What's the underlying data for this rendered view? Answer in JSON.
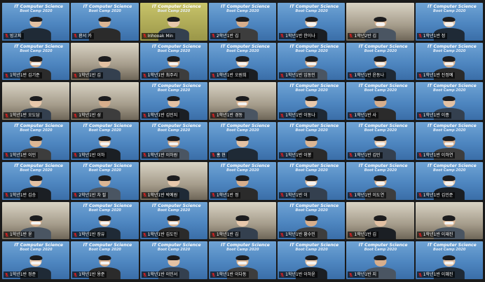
{
  "app": {
    "name": "Video Meeting Gallery View"
  },
  "banner": {
    "line1": "IT Computer Science",
    "line2": "Boot Camp 2020"
  },
  "colors": {
    "banner_blue": "#4e86c0",
    "active_speaker_border": "#c7e04a",
    "muted_icon": "#e02020"
  },
  "participants": [
    {
      "name": "빙고피",
      "bg": "banner",
      "mask": false,
      "active": true
    },
    {
      "name": "환서 카",
      "bg": "banner",
      "mask": false
    },
    {
      "name": "Inhooak Min",
      "bg": "yellow",
      "mask": false
    },
    {
      "name": "2학년1반 김",
      "bg": "banner",
      "mask": false
    },
    {
      "name": "1학년1반 한이나",
      "bg": "banner",
      "mask": true
    },
    {
      "name": "1학년2반 김",
      "bg": "room",
      "mask": true
    },
    {
      "name": "1학년1반 정",
      "bg": "banner",
      "mask": true
    },
    {
      "name": "1학년1반 김기준",
      "bg": "banner",
      "mask": true
    },
    {
      "name": "1학년1반 김",
      "bg": "room",
      "mask": false
    },
    {
      "name": "1학년1반 최주리",
      "bg": "banner",
      "mask": true
    },
    {
      "name": "1학년1반 오원희",
      "bg": "banner",
      "mask": true
    },
    {
      "name": "1학년1반 임동인",
      "bg": "banner",
      "mask": true
    },
    {
      "name": "1학년1반 윤동나",
      "bg": "banner",
      "mask": true
    },
    {
      "name": "1학년1반 진정예",
      "bg": "banner",
      "mask": true
    },
    {
      "name": "1학년1반 오도담",
      "bg": "room",
      "mask": false
    },
    {
      "name": "1학년1반 성",
      "bg": "room",
      "mask": false
    },
    {
      "name": "1학년1반 김민지",
      "bg": "banner",
      "mask": false
    },
    {
      "name": "1학년1반 경동",
      "bg": "room",
      "mask": true
    },
    {
      "name": "1학년1반 이동나",
      "bg": "banner",
      "mask": false
    },
    {
      "name": "1학년1반 사",
      "bg": "banner",
      "mask": false
    },
    {
      "name": "1학년1반 이종",
      "bg": "banner",
      "mask": false
    },
    {
      "name": "1학년1반 이민",
      "bg": "banner",
      "mask": false
    },
    {
      "name": "1학년1반 이하",
      "bg": "banner",
      "mask": true
    },
    {
      "name": "1학년1반 이하원",
      "bg": "banner",
      "mask": true
    },
    {
      "name": "홍 현",
      "bg": "banner",
      "mask": false
    },
    {
      "name": "1학년1반 이봉",
      "bg": "banner",
      "mask": false
    },
    {
      "name": "1학년1반 김민",
      "bg": "banner",
      "mask": true
    },
    {
      "name": "1학년1반 이하연",
      "bg": "banner",
      "mask": true
    },
    {
      "name": "1학년1반 김승",
      "bg": "banner",
      "mask": false
    },
    {
      "name": "2학년1반 차 필",
      "bg": "banner",
      "mask": false
    },
    {
      "name": "1학년1반 박예원",
      "bg": "room",
      "mask": false
    },
    {
      "name": "1학년1반 정",
      "bg": "banner",
      "mask": false
    },
    {
      "name": "1학년1반 이",
      "bg": "banner",
      "mask": true
    },
    {
      "name": "1학년1반 이도연",
      "bg": "banner",
      "mask": true
    },
    {
      "name": "1학년1반 김민준",
      "bg": "banner",
      "mask": true
    },
    {
      "name": "1학년1반 윤",
      "bg": "room",
      "mask": true
    },
    {
      "name": "1학년1반 장유",
      "bg": "banner",
      "mask": true
    },
    {
      "name": "1학년1반 김도민",
      "bg": "banner",
      "mask": true
    },
    {
      "name": "1학년1반 김",
      "bg": "room",
      "mask": false
    },
    {
      "name": "1학년1반 황수민",
      "bg": "banner",
      "mask": false
    },
    {
      "name": "1학년1반 김",
      "bg": "room",
      "mask": false
    },
    {
      "name": "1학년1반 이재진",
      "bg": "room",
      "mask": true
    },
    {
      "name": "1학년1반 정준",
      "bg": "banner",
      "mask": true
    },
    {
      "name": "1학년1반 용준",
      "bg": "banner",
      "mask": true
    },
    {
      "name": "1학년1반 이민서",
      "bg": "banner",
      "mask": false
    },
    {
      "name": "1학년1반 이다동",
      "bg": "banner",
      "mask": true
    },
    {
      "name": "1학년1반 이하윤",
      "bg": "banner",
      "mask": true
    },
    {
      "name": "1학년1반 지",
      "bg": "banner",
      "mask": false
    },
    {
      "name": "1학년1반 이혜진",
      "bg": "banner",
      "mask": true
    }
  ]
}
